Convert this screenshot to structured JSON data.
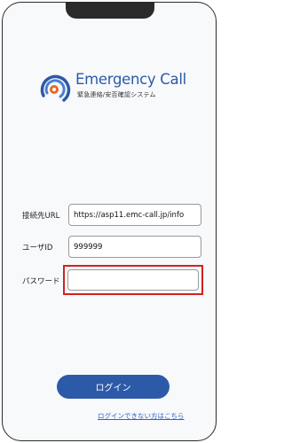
{
  "logo": {
    "title": "Emergency Call",
    "subtitle": "緊急連絡/安否確認システム"
  },
  "form": {
    "url_label": "接続先URL",
    "url_value": "https://asp11.emc-call.jp/info",
    "userid_label": "ユーザID",
    "userid_value": "999999",
    "password_label": "パスワード",
    "password_value": ""
  },
  "actions": {
    "login_label": "ログイン",
    "help_link": "ログインできない方はこちら"
  },
  "colors": {
    "brand": "#2c5aa7",
    "button": "#2d5aa8",
    "link": "#2a62c4",
    "highlight": "#d62020"
  }
}
